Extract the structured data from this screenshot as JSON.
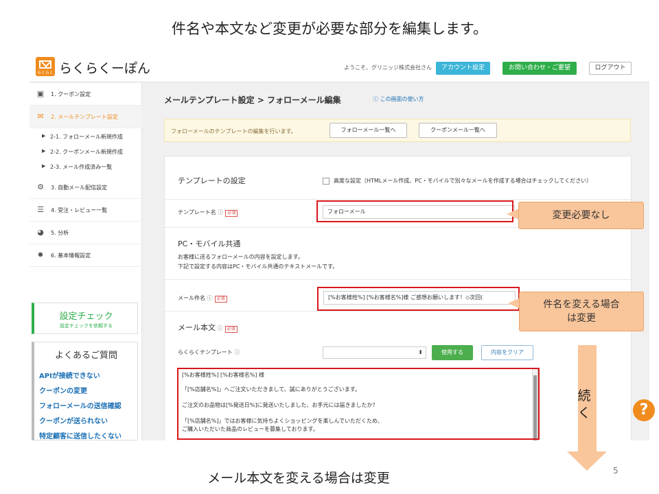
{
  "slide": {
    "title": "件名や本文など変更が必要な部分を編集します。",
    "footer": "メール本文を変える場合は変更",
    "page_number": "5",
    "continue_label": "続く",
    "callout_1": "変更必要なし",
    "callout_2_line1": "件名を変える場合",
    "callout_2_line2": "は変更"
  },
  "header": {
    "logo_sub": "らくらく",
    "app_name": "らくらくーぽん",
    "welcome": "ようこそ、グリニッジ株式会社さん",
    "account_button": "アカウント設定",
    "contact_button": "お問い合わせ・ご要望",
    "logout_button": "ログアウト"
  },
  "sidebar": {
    "items": [
      {
        "label": "1. クーポン設定",
        "icon": "coupon-icon"
      },
      {
        "label": "2. メールテンプレート設定",
        "icon": "mail-icon"
      },
      {
        "label": "3. 自動メール配信設定",
        "icon": "gears-icon"
      },
      {
        "label": "4. 受注・レビュー一覧",
        "icon": "list-icon"
      },
      {
        "label": "5. 分析",
        "icon": "pie-chart-icon"
      },
      {
        "label": "6. 基本情報設定",
        "icon": "gear-icon"
      }
    ],
    "sub_items": [
      {
        "label": "2-1. フォローメール新規作成"
      },
      {
        "label": "2-2. クーポンメール新規作成"
      },
      {
        "label": "2-3. メール作成済み一覧"
      }
    ],
    "check_title": "設定チェック",
    "check_sub": "設定チェックを依頼する",
    "faq_title": "よくあるご質問",
    "faq_links": [
      "APIが接続できない",
      "クーポンの変更",
      "フォローメールの送信確認",
      "クーポンが送られない",
      "特定顧客に送信したくない"
    ]
  },
  "main": {
    "breadcrumb": "メールテンプレート設定 > フォローメール編集",
    "help_link": "この画面の使い方",
    "notice_text": "フォローメールのテンプレートの編集を行います。",
    "btn_follow_list": "フォローメール一覧へ",
    "btn_coupon_list": "クーポンメール一覧へ",
    "template_section": "テンプレートの設定",
    "advanced_label": "高度な設定（HTMLメール作成、PC・モバイルで別々なメールを作成する場合はチェックしてください）",
    "template_name_label": "テンプレート名",
    "required": "必須",
    "template_name_value": "フォローメール",
    "common_section": "PC・モバイル共通",
    "desc_1": "お客様に送るフォローメールの内容を設定します。",
    "desc_2": "下記で設定する内容はPC・モバイル共通のテキストメールです。",
    "subject_label": "メール件名",
    "subject_value": "[%お客様姓%] [%お客様名%]様 ご感想お願いします！◇次回(",
    "body_label": "メール本文",
    "rakuraku_template_label": "らくらくテンプレート",
    "use_button": "使用する",
    "clear_button": "内容をクリア",
    "body_lines": [
      "[%お客様姓%] [%お客様名%] 様",
      "「[%店舗名%]」へご注文いただきまして、誠にありがとうございます。",
      "ご注文のお品物は[%発送日%]に発送いたしました、お手元には届きましたか？",
      "「[%店舗名%]」ではお客様に気持ちよくショッピングを楽しんでいただくため、",
      "ご購入いただいた商品のレビューを募集しております。"
    ]
  }
}
